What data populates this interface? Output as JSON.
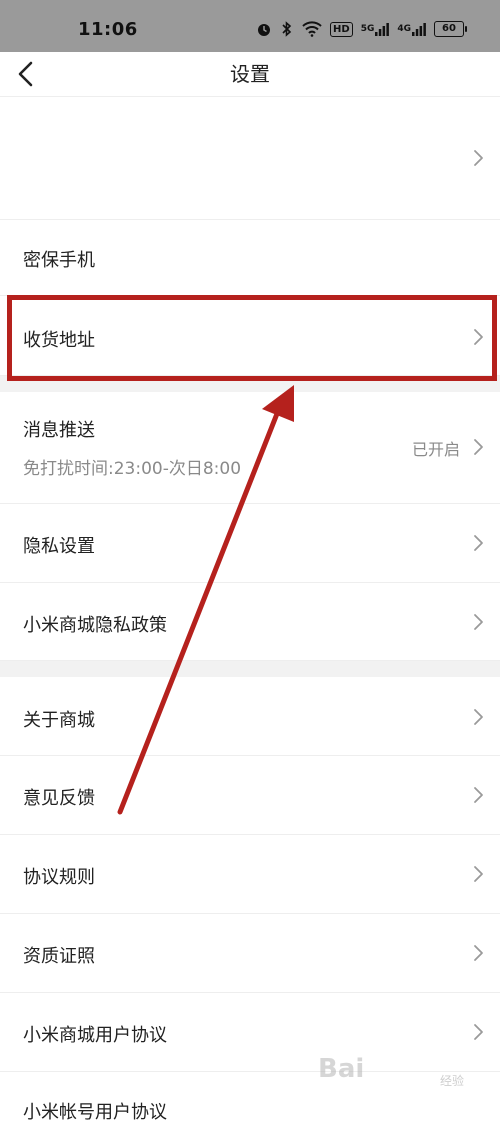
{
  "status_bar": {
    "time": "11:06",
    "icons": [
      "alarm-icon",
      "bluetooth-icon",
      "wifi-icon",
      "hd-icon",
      "signal-5g-icon",
      "signal-4g-icon"
    ],
    "hd_label": "HD",
    "signal1_label": "5G",
    "signal2_label": "4G",
    "battery": "60"
  },
  "header": {
    "title": "设置"
  },
  "rows": {
    "account": {
      "label": ""
    },
    "security_phone": {
      "label": "密保手机"
    },
    "address": {
      "label": "收货地址"
    },
    "push": {
      "label": "消息推送",
      "subtitle": "免打扰时间:23:00-次日8:00",
      "value": "已开启"
    },
    "privacy_settings": {
      "label": "隐私设置"
    },
    "mall_privacy_policy": {
      "label": "小米商城隐私政策"
    },
    "about": {
      "label": "关于商城"
    },
    "feedback": {
      "label": "意见反馈"
    },
    "rules": {
      "label": "协议规则"
    },
    "qualification": {
      "label": "资质证照"
    },
    "user_agreement": {
      "label": "小米商城用户协议"
    },
    "account_agreement": {
      "label": "小米帐号用户协议"
    }
  },
  "annotation": {
    "highlight_color": "#b5211d",
    "arrow_color": "#b5211d"
  },
  "watermark": {
    "text": "Bai",
    "sub": "经验"
  }
}
